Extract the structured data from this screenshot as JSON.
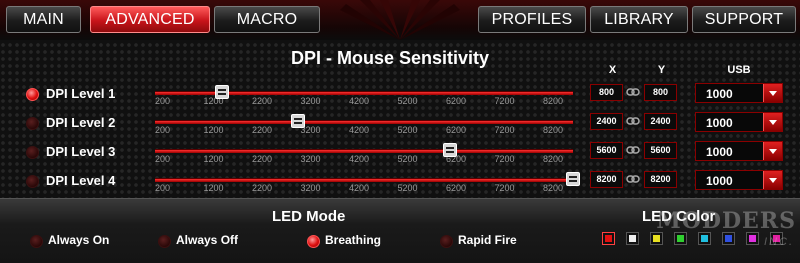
{
  "tabs": [
    {
      "label": "MAIN",
      "active": false
    },
    {
      "label": "ADVANCED",
      "active": true
    },
    {
      "label": "MACRO",
      "active": false
    },
    {
      "label": "PROFILES",
      "active": false
    },
    {
      "label": "LIBRARY",
      "active": false
    },
    {
      "label": "SUPPORT",
      "active": false
    }
  ],
  "dpi": {
    "title": "DPI - Mouse Sensitivity",
    "col_x": "X",
    "col_y": "Y",
    "col_usb": "USB",
    "ticks": [
      "200",
      "1200",
      "2200",
      "3200",
      "4200",
      "5200",
      "6200",
      "7200",
      "8200"
    ],
    "slider_min": 200,
    "slider_max": 8200,
    "levels": [
      {
        "label": "DPI Level 1",
        "selected": true,
        "x": "800",
        "y": "800",
        "usb": "1000",
        "value": 800
      },
      {
        "label": "DPI Level 2",
        "selected": false,
        "x": "2400",
        "y": "2400",
        "usb": "1000",
        "value": 2400
      },
      {
        "label": "DPI Level 3",
        "selected": false,
        "x": "5600",
        "y": "5600",
        "usb": "1000",
        "value": 5600
      },
      {
        "label": "DPI Level 4",
        "selected": false,
        "x": "8200",
        "y": "8200",
        "usb": "1000",
        "value": 8200
      }
    ]
  },
  "led": {
    "mode_title": "LED Mode",
    "color_title": "LED Color",
    "modes": [
      {
        "label": "Always On",
        "selected": false
      },
      {
        "label": "Always Off",
        "selected": false
      },
      {
        "label": "Breathing",
        "selected": true
      },
      {
        "label": "Rapid Fire",
        "selected": false
      }
    ],
    "colors": [
      "#e01010",
      "#f0f0f0",
      "#e8e020",
      "#30d030",
      "#20c0e0",
      "#3050e0",
      "#e030e0",
      "#e020a0"
    ],
    "selected_color": 0
  },
  "watermark": {
    "line1": "MODDERS",
    "line2": "INC."
  }
}
